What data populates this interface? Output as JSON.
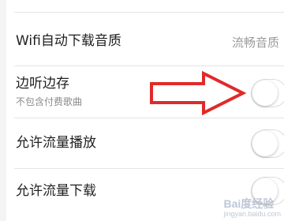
{
  "settings": {
    "rows": [
      {
        "title": "",
        "value": ""
      },
      {
        "title": "Wifi自动下载音质",
        "value": "流畅音质"
      },
      {
        "title": "边听边存",
        "subtitle": "不包含付费歌曲",
        "toggle_on": false
      },
      {
        "title": "允许流量播放",
        "toggle_on": false
      },
      {
        "title": "允许流量下载",
        "toggle_on": false
      }
    ]
  },
  "annotation": {
    "type": "red-outline-arrow",
    "color": "#e02a2a"
  },
  "watermark": {
    "brand": "Bai度经验",
    "url": "jingyan.baidu.com"
  }
}
